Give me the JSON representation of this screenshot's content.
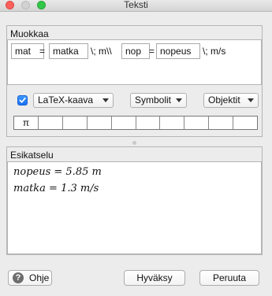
{
  "window": {
    "title": "Teksti"
  },
  "editor": {
    "section_label": "Muokkaa",
    "tokens": {
      "mat": "mat",
      "eq1": "=",
      "matka": "matka",
      "mid": "\\; m\\\\",
      "nop": "nop",
      "eq2": "=",
      "nopeus": "nopeus",
      "tail": "\\; m/s"
    }
  },
  "toolbar": {
    "latex_checked": true,
    "latex_label": "LaTeX-kaava",
    "symbols_label": "Symbolit",
    "objects_label": "Objektit"
  },
  "symbols": [
    "π",
    "",
    "",
    "",
    "",
    "",
    "",
    "",
    "",
    ""
  ],
  "preview": {
    "section_label": "Esikatselu",
    "line1": "nopeus = 5.85 m",
    "line2": "matka = 1.3 m/s"
  },
  "buttons": {
    "help": "Ohje",
    "help_icon_glyph": "?",
    "ok": "Hyväksy",
    "cancel": "Peruuta"
  },
  "colors": {
    "checkbox_accent": "#1d6ff2",
    "close": "#fc605c",
    "maximize": "#34c84a"
  }
}
